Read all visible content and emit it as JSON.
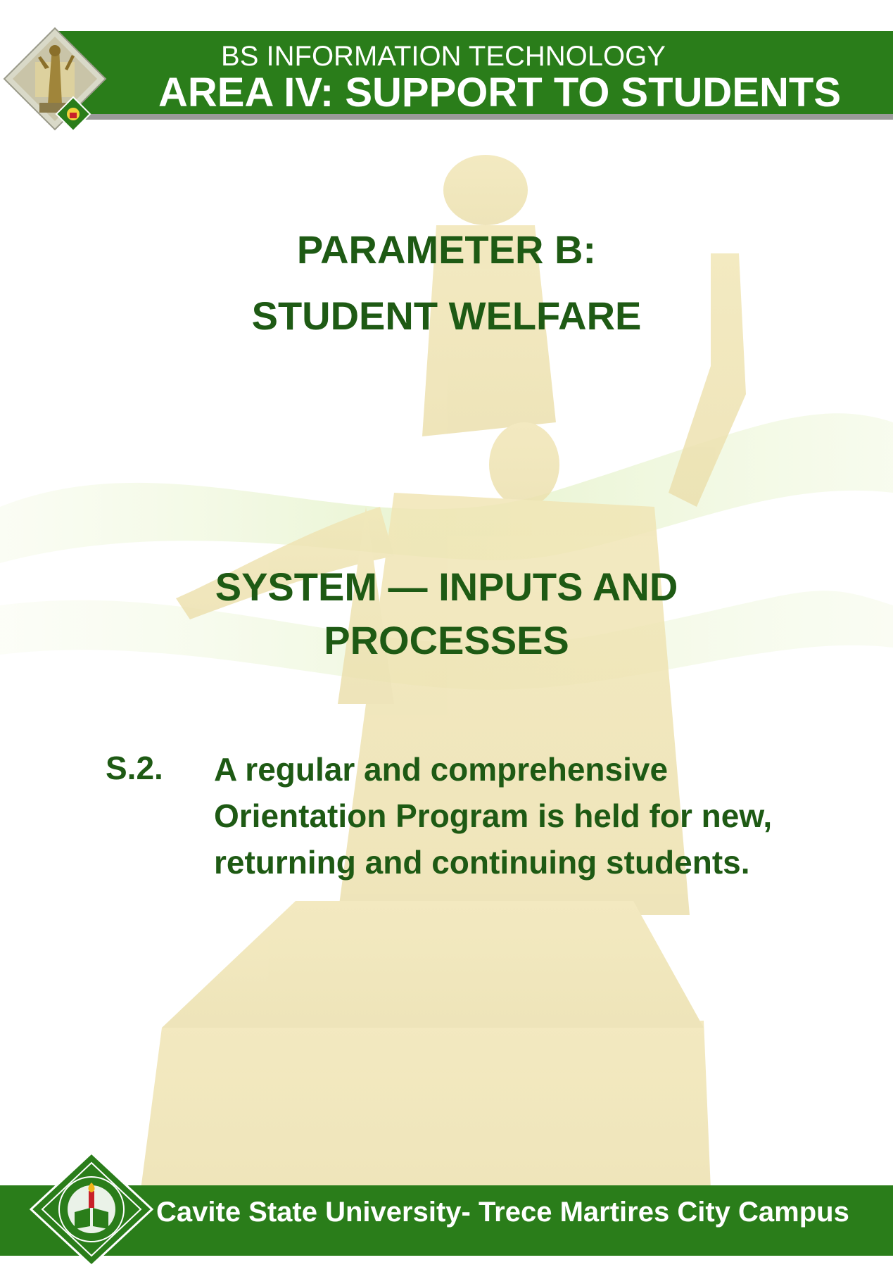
{
  "header": {
    "subtitle": "BS INFORMATION TECHNOLOGY",
    "title": "AREA IV: SUPPORT TO STUDENTS"
  },
  "parameter": {
    "title": "PARAMETER B:",
    "subtitle": "STUDENT WELFARE"
  },
  "section": {
    "line1": "SYSTEM — INPUTS AND",
    "line2": "PROCESSES"
  },
  "item": {
    "number": "S.2.",
    "text": "A regular and comprehensive Orientation Program is held for new, returning and continuing students."
  },
  "footer": {
    "text": "Cavite State University- Trece Martires City Campus"
  },
  "colors": {
    "brand_green": "#2a7d1a",
    "text_green": "#1e5a14"
  }
}
